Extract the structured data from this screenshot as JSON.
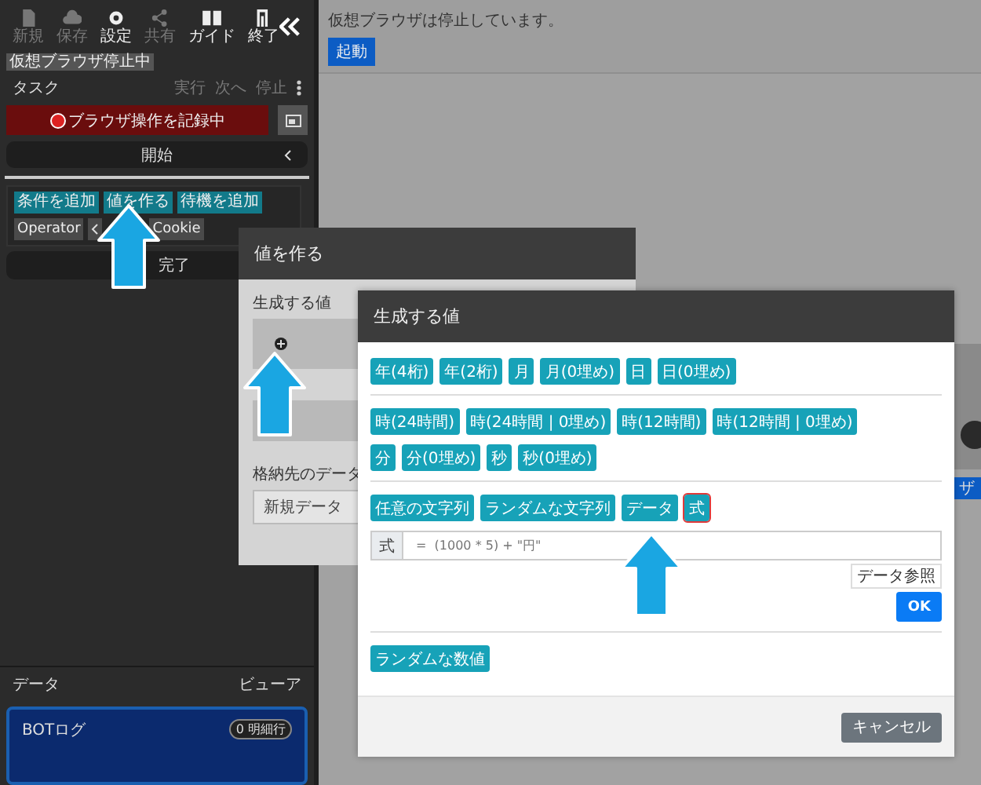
{
  "sidebar": {
    "toolbar": [
      {
        "label": "新規",
        "disabled": true
      },
      {
        "label": "保存",
        "disabled": true
      },
      {
        "label": "設定",
        "disabled": false
      },
      {
        "label": "共有",
        "disabled": true
      },
      {
        "label": "ガイド",
        "disabled": false
      },
      {
        "label": "終了",
        "disabled": false
      }
    ],
    "status_badge": "仮想ブラウザ停止中",
    "task": {
      "title": "タスク",
      "actions": [
        {
          "label": "実行",
          "disabled": true
        },
        {
          "label": "次へ",
          "disabled": true
        },
        {
          "label": "停止",
          "disabled": true
        }
      ]
    },
    "record_button": "ブラウザ操作を記録中",
    "start_step": "開始",
    "action_buttons": [
      {
        "label": "条件を追加",
        "kind": "primary"
      },
      {
        "label": "値を作る",
        "kind": "primary"
      },
      {
        "label": "待機を追加",
        "kind": "primary"
      },
      {
        "label": "Operator",
        "kind": "secondary"
      },
      {
        "kind": "secondary"
      },
      {
        "label": "Cookie",
        "kind": "secondary"
      }
    ],
    "end_step": "完了",
    "data": {
      "title": "データ",
      "viewer": "ビューア",
      "log": {
        "title": "BOTログ",
        "badge": "0 明細行"
      }
    }
  },
  "main": {
    "message": "仮想ブラウザは停止しています。",
    "start_button": "起動",
    "background_text": "ザ"
  },
  "make_value_dialog": {
    "title": "値を作る",
    "value_label": "生成する値",
    "storage_label": "格納先のデータ",
    "storage_value": "新規データ"
  },
  "generate_dialog": {
    "title": "生成する値",
    "sections": [
      {
        "button_rows": [
          {
            "buttons": [
              {
                "label": "年(4桁)",
                "selected": false
              },
              {
                "label": "年(2桁)",
                "selected": false
              },
              {
                "label": "月",
                "selected": false
              },
              {
                "label": "月(0埋め)",
                "selected": false
              },
              {
                "label": "日",
                "selected": false
              },
              {
                "label": "日(0埋め)",
                "selected": false
              }
            ]
          }
        ]
      },
      {
        "button_rows": [
          {
            "buttons": [
              {
                "label": "時(24時間)",
                "selected": false
              },
              {
                "label": "時(24時間 | 0埋め)",
                "selected": false
              },
              {
                "label": "時(12時間)",
                "selected": false
              },
              {
                "label": "時(12時間 | 0埋め)",
                "selected": false
              }
            ]
          },
          {
            "buttons": [
              {
                "label": "分",
                "selected": false
              },
              {
                "label": "分(0埋め)",
                "selected": false
              },
              {
                "label": "秒",
                "selected": false
              },
              {
                "label": "秒(0埋め)",
                "selected": false
              }
            ]
          }
        ]
      },
      {
        "button_rows": [
          {
            "buttons": [
              {
                "label": "任意の文字列",
                "selected": false
              },
              {
                "label": "ランダムな文字列",
                "selected": false
              },
              {
                "label": "データ",
                "selected": false
              },
              {
                "label": "式",
                "selected": true
              }
            ]
          }
        ],
        "formula": {
          "prefix": "式",
          "placeholder": "=  (1000 * 5) + \"円\"",
          "data_ref": "データ参照",
          "ok": "OK"
        }
      },
      {
        "button_rows": [
          {
            "buttons": [
              {
                "label": "ランダムな数値",
                "selected": false
              }
            ]
          }
        ]
      }
    ],
    "cancel": "キャンセル"
  }
}
